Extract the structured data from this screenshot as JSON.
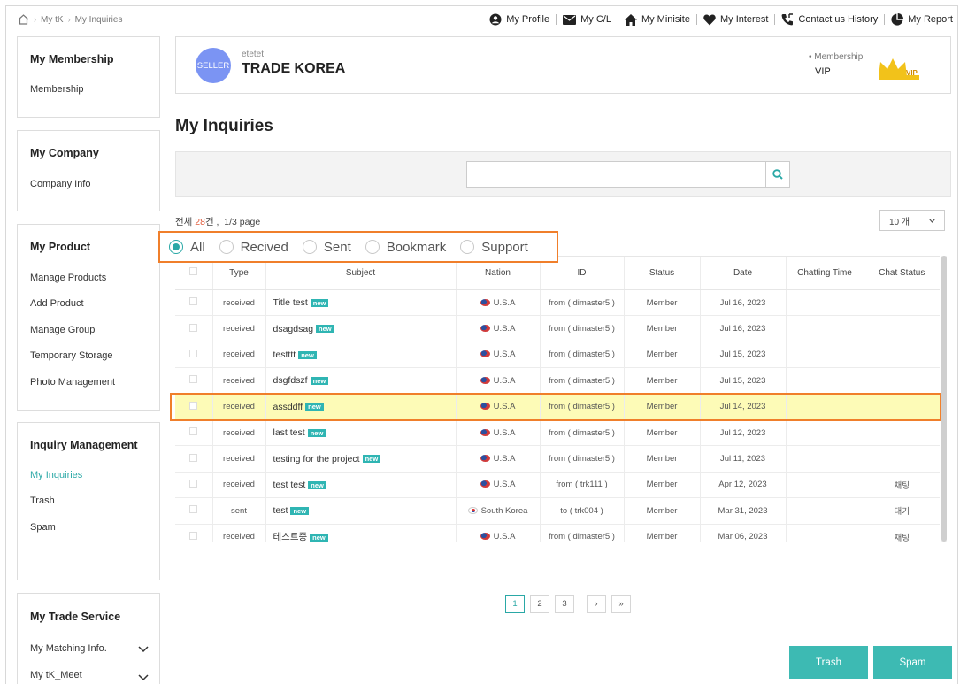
{
  "breadcrumb": {
    "items": [
      "My tK",
      "My Inquiries"
    ]
  },
  "top_links": [
    "My Profile",
    "My C/L",
    "My Minisite",
    "My Interest",
    "Contact us History",
    "My Report"
  ],
  "sidebar": {
    "sections": [
      {
        "title": "My Membership",
        "items": [
          "Membership"
        ]
      },
      {
        "title": "My Company",
        "items": [
          "Company Info"
        ]
      },
      {
        "title": "My Product",
        "items": [
          "Manage Products",
          "Add Product",
          "Manage Group",
          "Temporary Storage",
          "Photo Management"
        ]
      },
      {
        "title": "Inquiry Management",
        "items": [
          "My Inquiries",
          "Trash",
          "Spam"
        ]
      },
      {
        "title": "My Trade Service",
        "items": [
          "My Matching Info.",
          "My tK_Meet"
        ]
      }
    ]
  },
  "profile": {
    "avatar_label": "SELLER",
    "username": "etetet",
    "company": "TRADE KOREA",
    "membership_label": "• Membership",
    "membership_value": "VIP",
    "vip_text": "VIP"
  },
  "page_title": "My Inquiries",
  "search": {
    "placeholder": ""
  },
  "count": {
    "prefix": "전체",
    "total": "28",
    "suffix": "건 ,",
    "page_info": "1/3 page"
  },
  "per_page": "10 개",
  "filters": {
    "options": [
      "All",
      "Recived",
      "Sent",
      "Bookmark",
      "Support"
    ],
    "selected": "All"
  },
  "table": {
    "headers": [
      "Type",
      "Subject",
      "Nation",
      "ID",
      "Status",
      "Date",
      "Chatting Time",
      "Chat Status"
    ],
    "new_tag": "new",
    "rows": [
      {
        "type": "received",
        "subject": "Title test",
        "nation": "U.S.A",
        "flag": "us",
        "id": "from ( dimaster5 )",
        "status": "Member",
        "date": "Jul 16, 2023",
        "chat_time": "",
        "chat_status": ""
      },
      {
        "type": "received",
        "subject": "dsagdsag",
        "nation": "U.S.A",
        "flag": "us",
        "id": "from ( dimaster5 )",
        "status": "Member",
        "date": "Jul 16, 2023",
        "chat_time": "",
        "chat_status": ""
      },
      {
        "type": "received",
        "subject": "testttt",
        "nation": "U.S.A",
        "flag": "us",
        "id": "from ( dimaster5 )",
        "status": "Member",
        "date": "Jul 15, 2023",
        "chat_time": "",
        "chat_status": ""
      },
      {
        "type": "received",
        "subject": "dsgfdszf",
        "nation": "U.S.A",
        "flag": "us",
        "id": "from ( dimaster5 )",
        "status": "Member",
        "date": "Jul 15, 2023",
        "chat_time": "",
        "chat_status": ""
      },
      {
        "type": "received",
        "subject": "assddff",
        "nation": "U.S.A",
        "flag": "us",
        "id": "from ( dimaster5 )",
        "status": "Member",
        "date": "Jul 14, 2023",
        "chat_time": "",
        "chat_status": ""
      },
      {
        "type": "received",
        "subject": "last test",
        "nation": "U.S.A",
        "flag": "us",
        "id": "from ( dimaster5 )",
        "status": "Member",
        "date": "Jul 12, 2023",
        "chat_time": "",
        "chat_status": ""
      },
      {
        "type": "received",
        "subject": "testing for the project",
        "nation": "U.S.A",
        "flag": "us",
        "id": "from ( dimaster5 )",
        "status": "Member",
        "date": "Jul 11, 2023",
        "chat_time": "",
        "chat_status": ""
      },
      {
        "type": "received",
        "subject": "test test",
        "nation": "U.S.A",
        "flag": "us",
        "id": "from ( trk111 )",
        "status": "Member",
        "date": "Apr 12, 2023",
        "chat_time": "",
        "chat_status": "채팅"
      },
      {
        "type": "sent",
        "subject": "test",
        "nation": "South Korea",
        "flag": "kr",
        "id": "to ( trk004 )",
        "status": "Member",
        "date": "Mar 31, 2023",
        "chat_time": "",
        "chat_status": "대기"
      },
      {
        "type": "received",
        "subject": "테스트중",
        "nation": "U.S.A",
        "flag": "us",
        "id": "from ( dimaster5 )",
        "status": "Member",
        "date": "Mar 06, 2023",
        "chat_time": "",
        "chat_status": "채팅"
      }
    ],
    "highlighted_row": 4
  },
  "pagination": {
    "pages": [
      "1",
      "2",
      "3"
    ],
    "current": "1",
    "next": "›",
    "last": "»"
  },
  "buttons": {
    "trash": "Trash",
    "spam": "Spam"
  },
  "colors": {
    "accent": "#2aa8a6",
    "highlight_border": "#f07f2b",
    "new_tag": "#2fb5b3",
    "button": "#3dbab3",
    "avatar": "#7b94f3"
  }
}
